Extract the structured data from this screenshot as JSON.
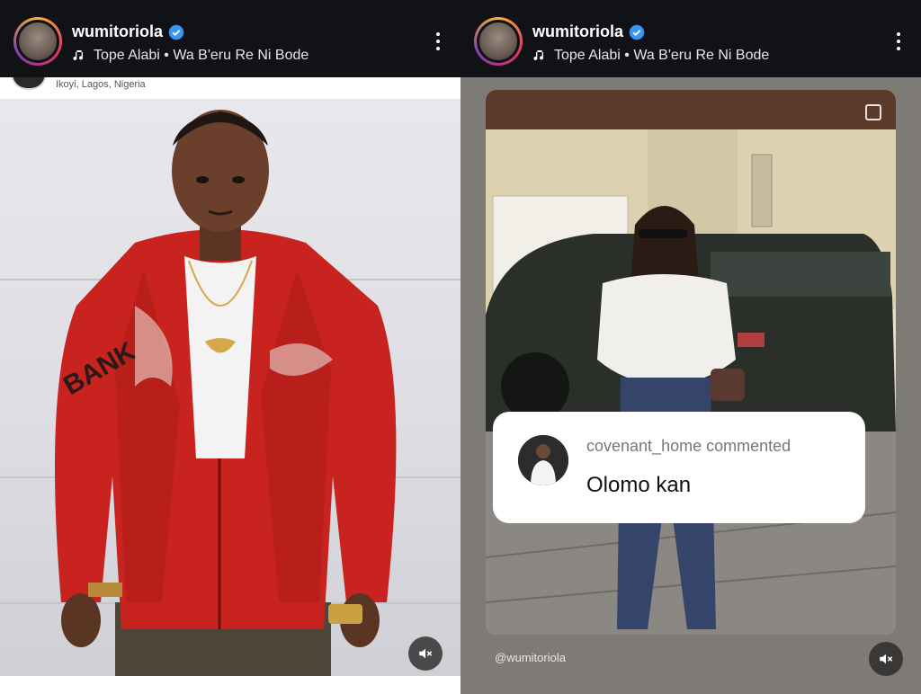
{
  "left_story": {
    "header": {
      "username": "wumitoriola",
      "verified": true,
      "music": "Tope Alabi • Wa B'eru Re Ni Bode"
    },
    "location": "Ikoyi, Lagos, Nigeria",
    "icons": [
      "verified-badge-icon",
      "music-note-icon",
      "more-options-icon",
      "mute-icon"
    ]
  },
  "right_story": {
    "header": {
      "username": "wumitoriola",
      "verified": true,
      "music": "Tope Alabi • Wa B'eru Re Ni Bode"
    },
    "comment": {
      "user_line": "covenant_home commented",
      "text": "Olomo kan"
    },
    "handle": "@wumitoriola",
    "icons": [
      "verified-badge-icon",
      "music-note-icon",
      "more-options-icon",
      "mute-icon"
    ]
  },
  "colors": {
    "header_bg": "#101215",
    "verified_blue": "#3897f0",
    "jacket_red": "#c8231e"
  }
}
